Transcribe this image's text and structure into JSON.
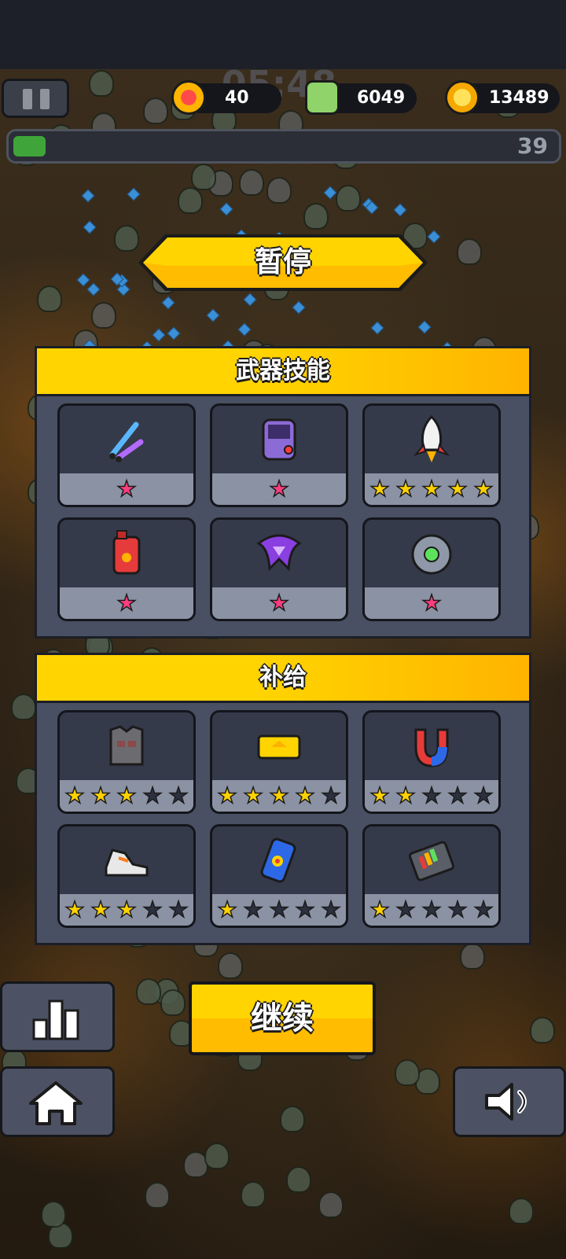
{
  "hud": {
    "timer": "05:48",
    "health": "40",
    "kills": "6049",
    "coins": "13489",
    "level": "39",
    "xp_fraction": 0.06
  },
  "pause": {
    "title": "暂停"
  },
  "weapons": {
    "title": "武器技能",
    "items": [
      {
        "icon": "twin-blades-icon",
        "stars": 1,
        "max_stars": 1
      },
      {
        "icon": "game-console-icon",
        "stars": 1,
        "max_stars": 1
      },
      {
        "icon": "rocket-icon",
        "stars": 5,
        "max_stars": 5
      },
      {
        "icon": "fuel-can-icon",
        "stars": 1,
        "max_stars": 1
      },
      {
        "icon": "purple-boomerang-icon",
        "stars": 1,
        "max_stars": 1
      },
      {
        "icon": "drone-orb-icon",
        "stars": 1,
        "max_stars": 1
      }
    ]
  },
  "supplies": {
    "title": "补给",
    "items": [
      {
        "icon": "armor-vest-icon",
        "stars": 3,
        "max_stars": 5
      },
      {
        "icon": "gold-ticket-icon",
        "stars": 4,
        "max_stars": 5
      },
      {
        "icon": "magnet-icon",
        "stars": 2,
        "max_stars": 5
      },
      {
        "icon": "sneaker-icon",
        "stars": 3,
        "max_stars": 5
      },
      {
        "icon": "energy-drink-icon",
        "stars": 1,
        "max_stars": 5
      },
      {
        "icon": "battery-pack-icon",
        "stars": 1,
        "max_stars": 5
      }
    ]
  },
  "buttons": {
    "continue": "继续"
  },
  "colors": {
    "accent": "#ffd400",
    "panel": "#4a5063",
    "star_active_weapon": "#ff3d7f",
    "star_active_supply": "#ffd200"
  }
}
